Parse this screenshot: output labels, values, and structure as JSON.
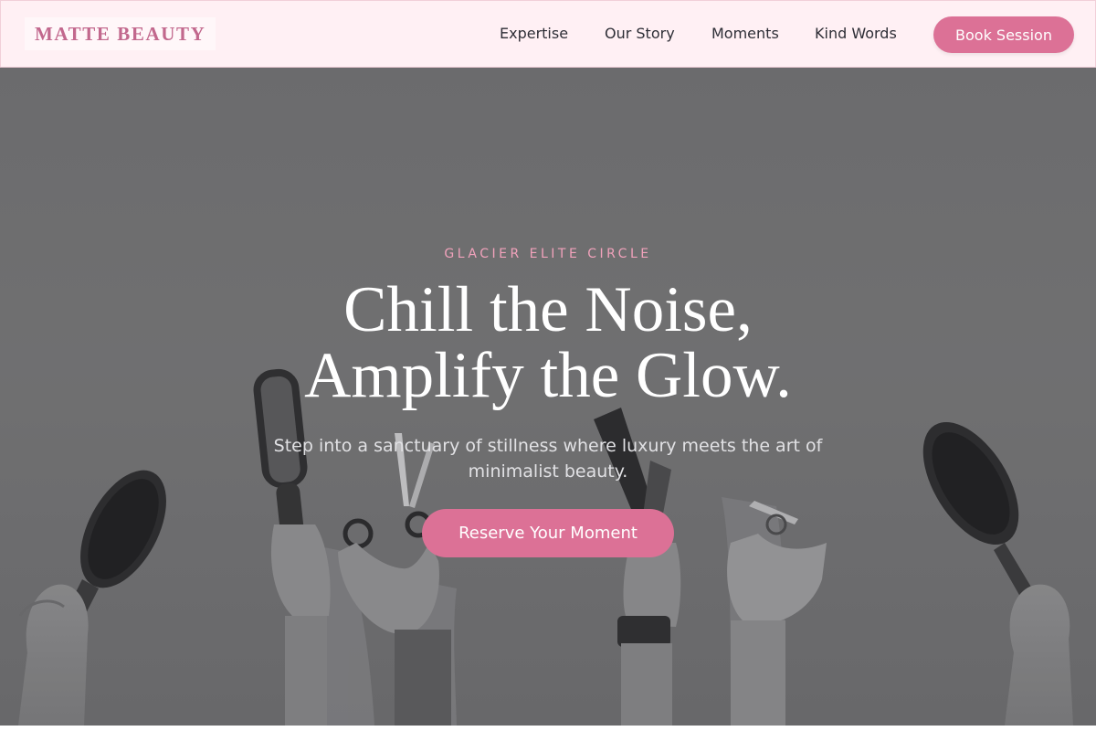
{
  "header": {
    "logo": "MATTE BEAUTY",
    "nav": [
      "Expertise",
      "Our Story",
      "Moments",
      "Kind Words"
    ],
    "cta": "Book Session"
  },
  "hero": {
    "kicker": "GLACIER ELITE CIRCLE",
    "headline_line1": "Chill the Noise,",
    "headline_line2": "Amplify the Glow.",
    "subtitle": "Step into a sanctuary of stillness where luxury meets the art of minimalist beauty.",
    "cta": "Reserve Your Moment",
    "image_description_icon": "hands-holding-beauty-tools-photo"
  },
  "colors": {
    "brand_pink": "#dc7196",
    "logo_pink": "#c2688d",
    "nav_background": "#fff0f4",
    "kicker_pink": "#f1a2bb",
    "hero_overlay_gray": "#707072"
  }
}
